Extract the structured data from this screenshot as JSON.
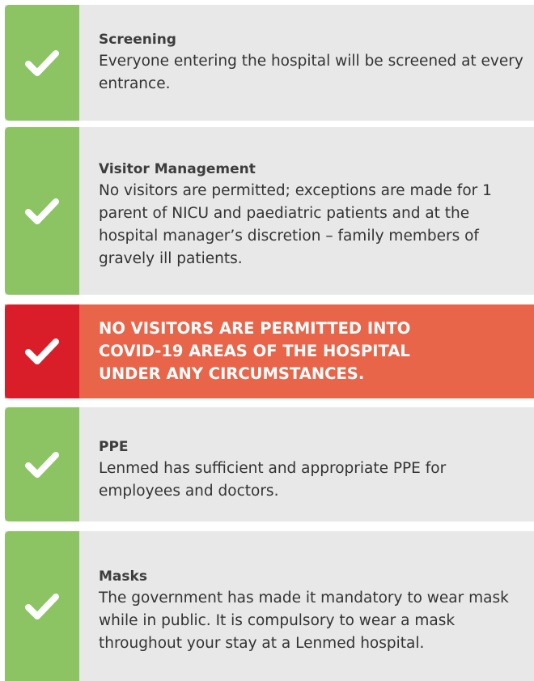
{
  "colors": {
    "green_strip": "#8cc463",
    "card_gray": "#e8e8e8",
    "red_strip": "#d91e2a",
    "orange_panel": "#e8654a",
    "check": "#ffffff"
  },
  "icon": "checkmark-icon",
  "items": [
    {
      "title": "Screening",
      "text": "Everyone entering the hospital will be screened at every entrance."
    },
    {
      "title": "Visitor Management",
      "text": "No visitors are permitted; exceptions are made for 1 parent of NICU and paediatric patients and at the hospital manager’s discretion – family members of gravely ill patients."
    },
    {
      "alert": "NO VISITORS ARE PERMITTED INTO COVID-19 AREAS OF THE HOSPITAL UNDER ANY CIRCUMSTANCES."
    },
    {
      "title": "PPE",
      "text": "Lenmed has sufficient and appropriate PPE for employees and doctors."
    },
    {
      "title": "Masks",
      "text": "The government has made it mandatory to wear mask while in public. It is compulsory to wear a mask throughout your stay at a Lenmed hospital."
    }
  ]
}
